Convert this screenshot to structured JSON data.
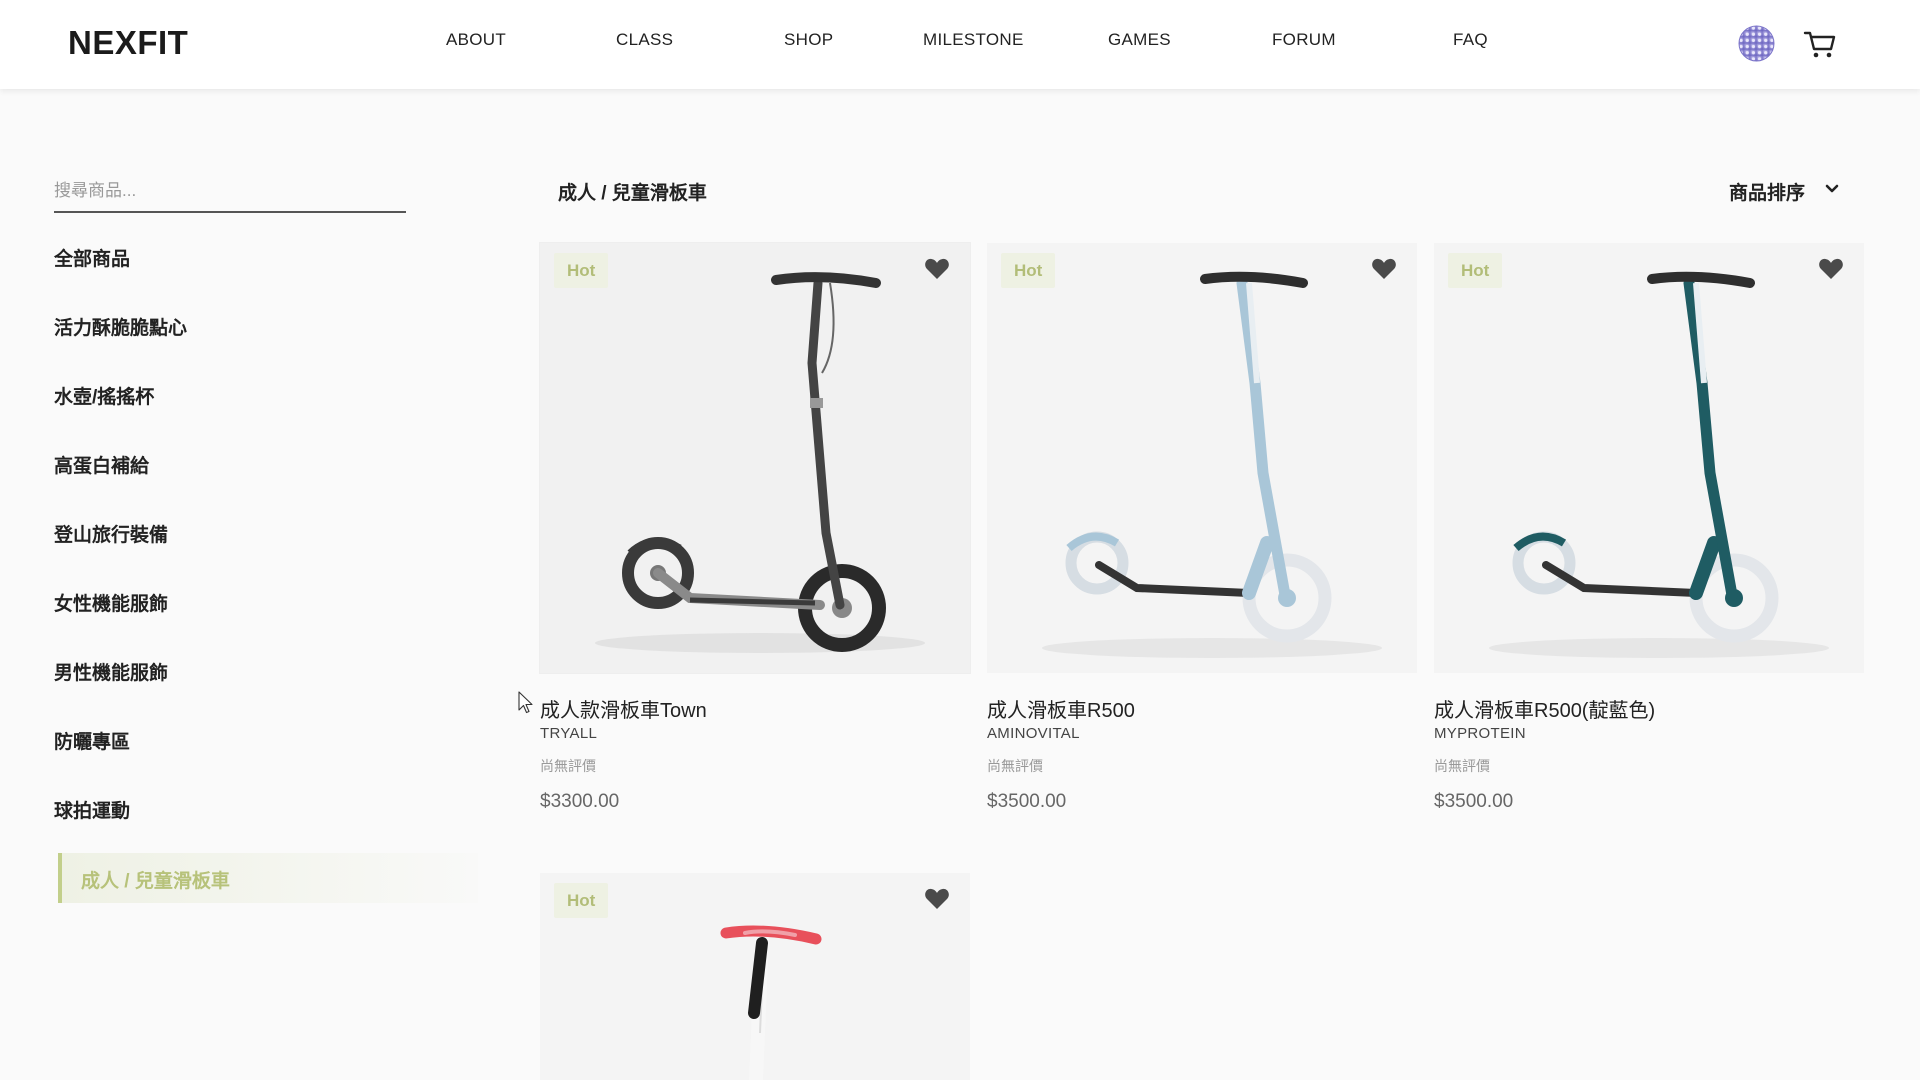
{
  "header": {
    "logo": "NEXFIT",
    "nav": [
      "ABOUT",
      "CLASS",
      "SHOP",
      "MILESTONE",
      "GAMES",
      "FORUM",
      "FAQ"
    ]
  },
  "icons": {
    "globe": "globe-icon",
    "cart": "cart-icon",
    "heart": "heart-icon",
    "sort_chevron": "chevron-down-icon"
  },
  "sidebar": {
    "search_placeholder": "搜尋商品...",
    "categories": [
      "全部商品",
      "活力酥脆脆點心",
      "水壺/搖搖杯",
      "高蛋白補給",
      "登山旅行裝備",
      "女性機能服飾",
      "男性機能服飾",
      "防曬專區",
      "球拍運動"
    ],
    "active_category": "成人 / 兒童滑板車"
  },
  "main": {
    "breadcrumb": "成人 / 兒童滑板車",
    "sort_label": "商品排序",
    "products": [
      {
        "badge": "Hot",
        "name": "成人款滑板車Town",
        "brand": "TRYALL",
        "rating": "尚無評價",
        "price": "$3300.00",
        "color": "#4a4a4a"
      },
      {
        "badge": "Hot",
        "name": "成人滑板車R500",
        "brand": "AMINOVITAL",
        "rating": "尚無評價",
        "price": "$3500.00",
        "color": "#a9c6d8"
      },
      {
        "badge": "Hot",
        "name": "成人滑板車R500(靛藍色)",
        "brand": "MYPROTEIN",
        "rating": "尚無評價",
        "price": "$3500.00",
        "color": "#1f5c63"
      },
      {
        "badge": "Hot"
      }
    ]
  },
  "colors": {
    "accent": "#b7c27a",
    "badge_bg": "#eef1e3",
    "text": "#222222"
  }
}
